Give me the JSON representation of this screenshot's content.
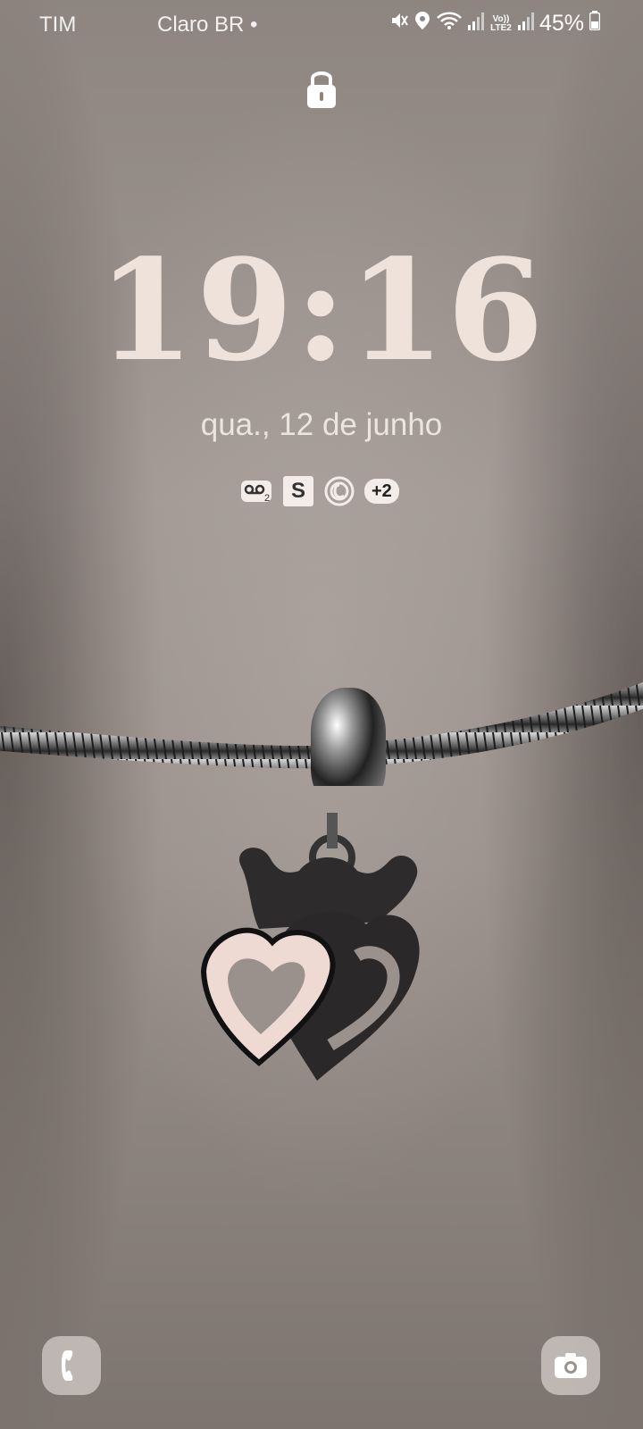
{
  "status_bar": {
    "left_carrier": "TIM",
    "carrier": "Claro BR",
    "carrier_dot": "•",
    "battery_percent": "45%",
    "icons": [
      "mute-icon",
      "location-icon",
      "wifi-icon",
      "signal-icon",
      "volte-lte2-icon",
      "signal-icon",
      "battery-icon"
    ],
    "volte_label": "Vo)) LTE2"
  },
  "lockscreen": {
    "time": "19:16",
    "date": "qua., 12 de junho",
    "notifications": [
      {
        "name": "voicemail-icon",
        "badge": "2"
      },
      {
        "name": "s-app-icon",
        "label": "S"
      },
      {
        "name": "threads-icon"
      }
    ],
    "more_notifications": "+2"
  },
  "shortcuts": {
    "left": "phone-icon",
    "right": "camera-icon"
  },
  "colors": {
    "clock": "#efe2da",
    "date": "#ece4df",
    "shortcut_bg": "#d7d0cc"
  },
  "wallpaper": "photo of a snake-chain bracelet with a double-heart crown charm on skin"
}
